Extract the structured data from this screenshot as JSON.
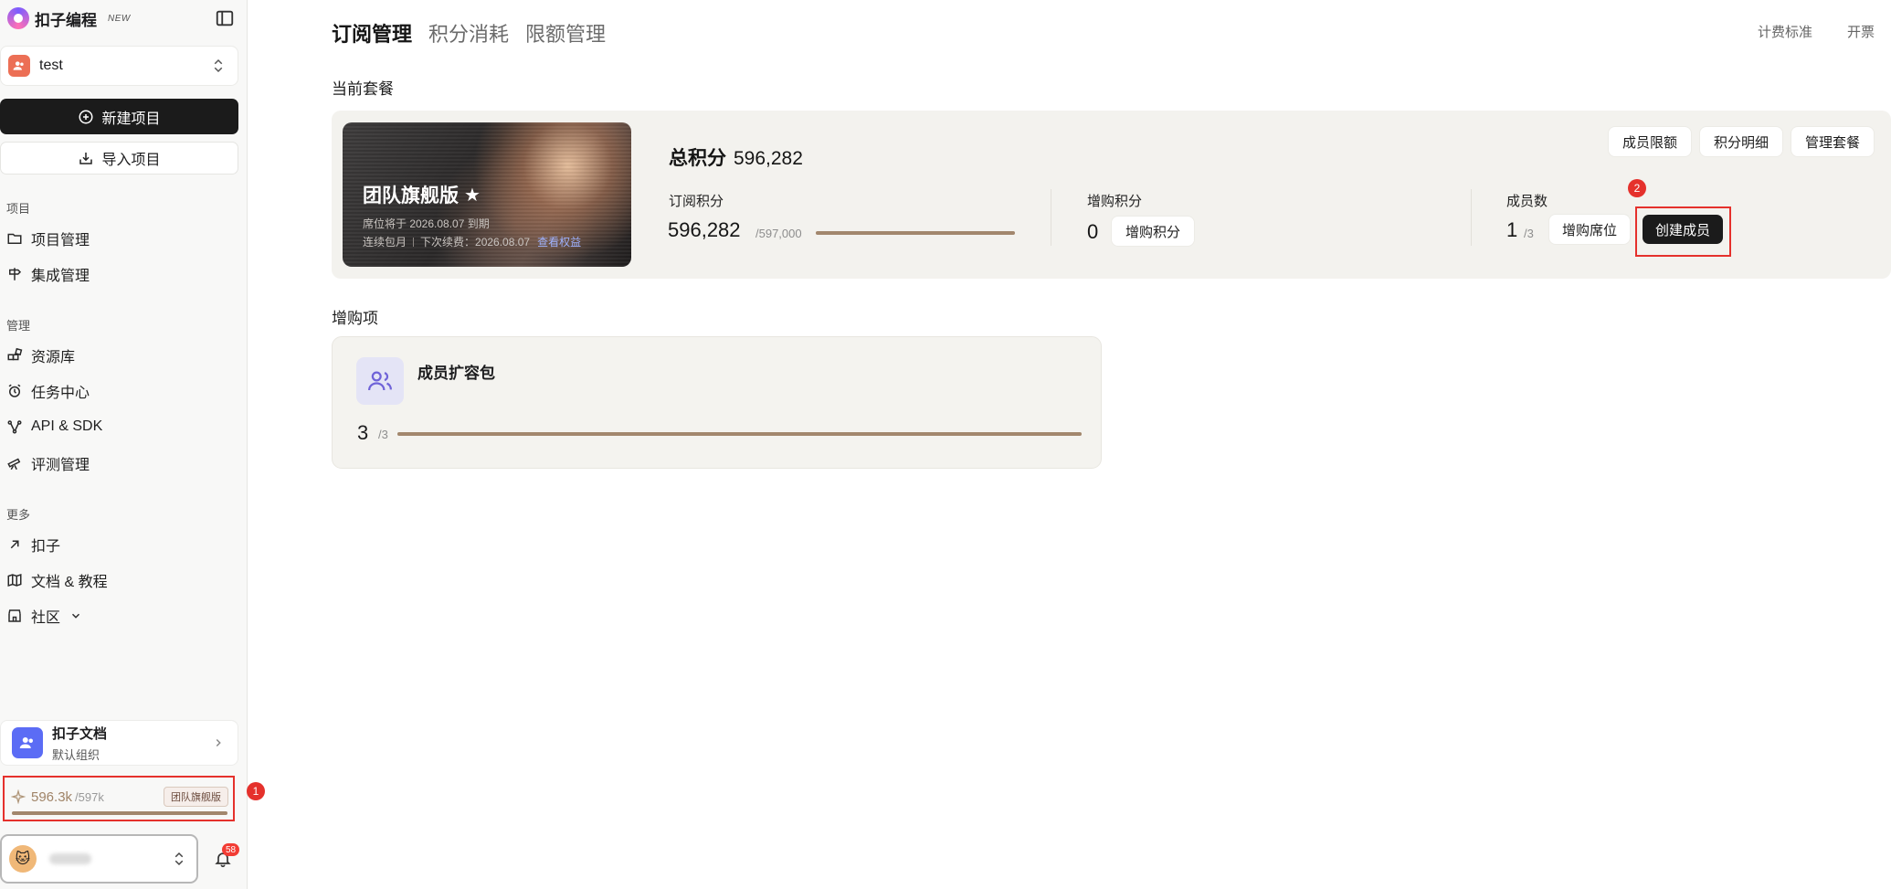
{
  "brand": {
    "name": "扣子编程",
    "badge": "NEW"
  },
  "workspace": {
    "name": "test"
  },
  "sidebar": {
    "new_project": "新建项目",
    "import_project": "导入项目",
    "sections": [
      {
        "title": "项目",
        "items": [
          {
            "label": "项目管理",
            "icon": "folder-icon"
          },
          {
            "label": "集成管理",
            "icon": "signpost-icon"
          }
        ]
      },
      {
        "title": "管理",
        "items": [
          {
            "label": "资源库",
            "icon": "blocks-icon"
          },
          {
            "label": "任务中心",
            "icon": "alarm-clock-icon"
          },
          {
            "label": "API & SDK",
            "icon": "nodes-icon"
          },
          {
            "label": "评测管理",
            "icon": "telescope-icon"
          }
        ]
      },
      {
        "title": "更多",
        "items": [
          {
            "label": "扣子",
            "icon": "arrow-up-right-icon"
          },
          {
            "label": "文档 & 教程",
            "icon": "map-icon"
          },
          {
            "label": "社区",
            "icon": "store-icon"
          }
        ]
      }
    ],
    "doc_card": {
      "title": "扣子文档",
      "subtitle": "默认组织"
    },
    "credits": {
      "value": "596.3k",
      "total": "/597k",
      "badge": "团队旗舰版",
      "progress": 0.9987
    },
    "notifications": {
      "count": "58"
    }
  },
  "annotations": {
    "one": "1",
    "two": "2"
  },
  "tabs": [
    "订阅管理",
    "积分消耗",
    "限额管理"
  ],
  "top_links": [
    "计费标准",
    "开票"
  ],
  "current_plan": {
    "section_title": "当前套餐",
    "plan_name": "团队旗舰版",
    "expire_text": "席位将于 2026.08.07 到期",
    "renew_mode": "连续包月",
    "next_renew": "下次续费：2026.08.07",
    "view_benefits": "查看权益",
    "total_label": "总积分",
    "total_value": "596,282",
    "subscription": {
      "label": "订阅积分",
      "value": "596,282",
      "of": "/597,000",
      "progress": 0.9988
    },
    "purchased": {
      "label": "增购积分",
      "value": "0",
      "button": "增购积分"
    },
    "members": {
      "label": "成员数",
      "value": "1",
      "of": "/3",
      "buy_seat": "增购席位",
      "create": "创建成员"
    },
    "actions": [
      "成员限额",
      "积分明细",
      "管理套餐"
    ]
  },
  "addons": {
    "section_title": "增购项",
    "item": {
      "title": "成员扩容包",
      "value": "3",
      "of": "/3",
      "progress": 1.0
    }
  },
  "colors": {
    "accent_brown": "#a2876d",
    "annotation_red": "#e5312c",
    "primary_dark": "#1b1b1b"
  }
}
